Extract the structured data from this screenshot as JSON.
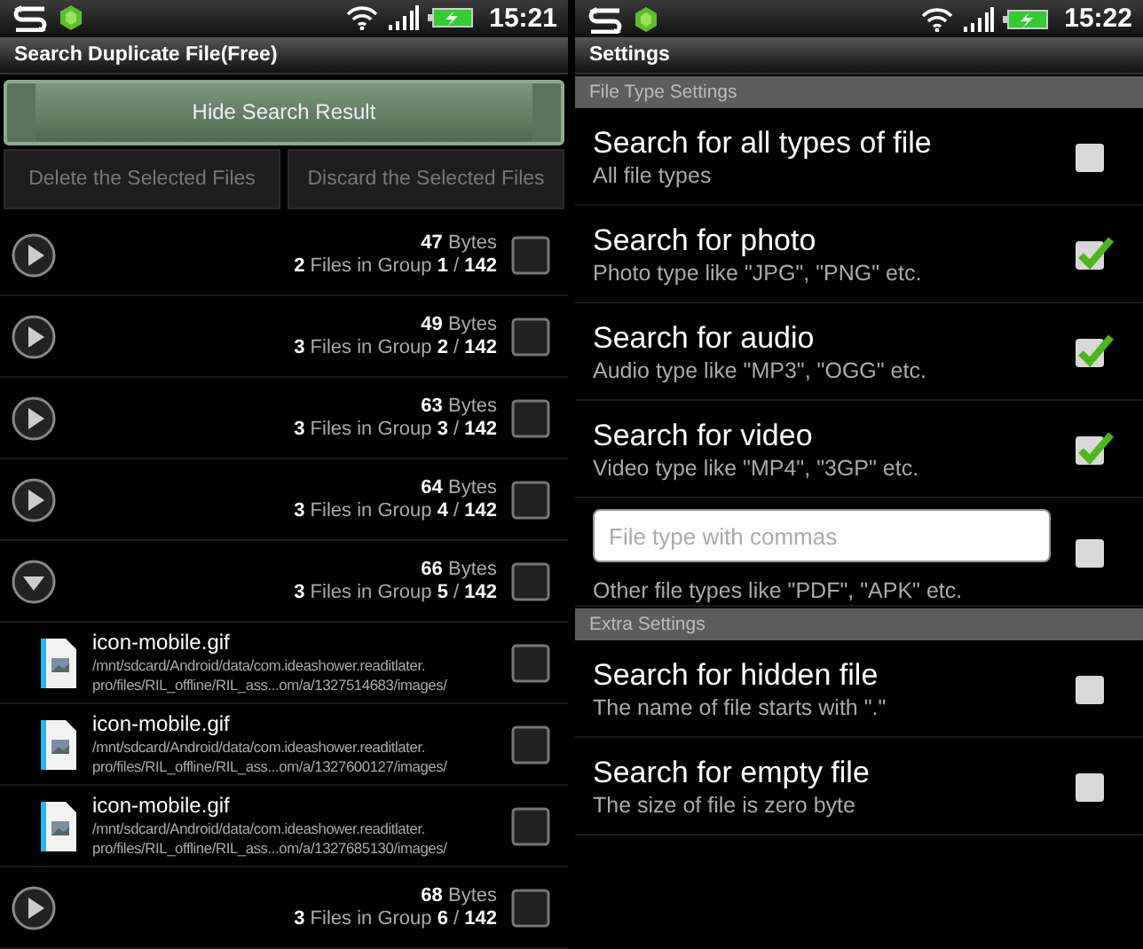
{
  "left_screen": {
    "status_bar": {
      "time": "15:21"
    },
    "title": "Search Duplicate File(Free)",
    "hide_button": "Hide Search Result",
    "action_buttons": [
      {
        "label": "Delete the Selected Files",
        "disabled": true
      },
      {
        "label": "Discard the Selected Files",
        "disabled": true
      }
    ],
    "groups": [
      {
        "size": "**47** Bytes",
        "summary": "**2** Files in Group **1** / **142**",
        "expanded": false,
        "checked": false
      },
      {
        "size": "**49** Bytes",
        "summary": "**3** Files in Group **2** / **142**",
        "expanded": false,
        "checked": false
      },
      {
        "size": "**63** Bytes",
        "summary": "**3** Files in Group **3** / **142**",
        "expanded": false,
        "checked": false
      },
      {
        "size": "**64** Bytes",
        "summary": "**3** Files in Group **4** / **142**",
        "expanded": false,
        "checked": false
      },
      {
        "size": "**66** Bytes",
        "summary": "**3** Files in Group **5** / **142**",
        "expanded": true,
        "checked": false,
        "files": [
          {
            "name": "icon-mobile.gif",
            "path_lines": [
              "/mnt/sdcard/Android/data/com.ideashower.readitlater.",
              "pro/files/RIL_offline/RIL_ass...om/a/1327514683/images/"
            ],
            "checked": false
          },
          {
            "name": "icon-mobile.gif",
            "path_lines": [
              "/mnt/sdcard/Android/data/com.ideashower.readitlater.",
              "pro/files/RIL_offline/RIL_ass...om/a/1327600127/images/"
            ],
            "checked": false
          },
          {
            "name": "icon-mobile.gif",
            "path_lines": [
              "/mnt/sdcard/Android/data/com.ideashower.readitlater.",
              "pro/files/RIL_offline/RIL_ass...om/a/1327685130/images/"
            ],
            "checked": false
          }
        ]
      },
      {
        "size": "**68** Bytes",
        "summary": "**3** Files in Group **6** / **142**",
        "expanded": false,
        "checked": false
      }
    ]
  },
  "right_screen": {
    "status_bar": {
      "time": "15:22"
    },
    "title": "Settings",
    "sections": [
      {
        "header": "File Type Settings",
        "items": [
          {
            "kind": "toggle",
            "title": "Search for all types of file",
            "summary": "All file types",
            "checked": false
          },
          {
            "kind": "toggle",
            "title": "Search for photo",
            "summary": "Photo type like \"JPG\", \"PNG\" etc.",
            "checked": true
          },
          {
            "kind": "toggle",
            "title": "Search for audio",
            "summary": "Audio type like \"MP3\", \"OGG\" etc.",
            "checked": true
          },
          {
            "kind": "toggle",
            "title": "Search for video",
            "summary": "Video type like \"MP4\", \"3GP\" etc.",
            "checked": true
          },
          {
            "kind": "input",
            "placeholder": "File type with commas",
            "summary": "Other file types like \"PDF\", \"APK\" etc.",
            "checked": false
          }
        ]
      },
      {
        "header": "Extra Settings",
        "items": [
          {
            "kind": "toggle",
            "title": "Search for hidden file",
            "summary": "The name of file starts with \".\"",
            "checked": false
          },
          {
            "kind": "toggle",
            "title": "Search for empty file",
            "summary": "The size of file is zero byte",
            "checked": false
          }
        ]
      }
    ]
  }
}
